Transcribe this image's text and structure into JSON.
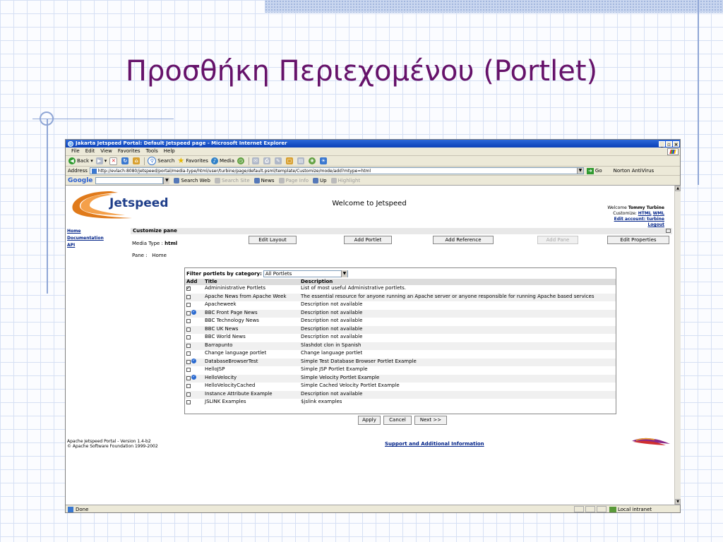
{
  "slide": {
    "title": "Προσθήκη Περιεχομένου (Portlet)"
  },
  "browser": {
    "title": "Jakarta Jetspeed Portal: Default Jetspeed page - Microsoft Internet Explorer",
    "window_buttons": [
      "_",
      "▫",
      "×"
    ],
    "menu": [
      "File",
      "Edit",
      "View",
      "Favorites",
      "Tools",
      "Help"
    ],
    "toolbar": {
      "back": "Back",
      "search": "Search",
      "favorites": "Favorites",
      "media": "Media"
    },
    "address_label": "Address",
    "url": "http://evlach:8080/jetspeed/portal/media-type/html/user/turbine/page/default.psml/template/Customize/mode/add?mtype=html",
    "go_label": "Go",
    "norton": "Norton AntiVirus",
    "googlebar": {
      "logo": "Google",
      "search_web": "Search Web",
      "search_site": "Search Site",
      "news": "News",
      "page_info": "Page Info",
      "up": "Up",
      "highlight": "Highlight"
    },
    "status": {
      "text": "Done",
      "zone": "Local intranet"
    }
  },
  "portal": {
    "logo_text": "Jetspeed",
    "welcome_center": "Welcome to Jetspeed",
    "welcome_user_prefix": "Welcome",
    "welcome_user": "Tommy Turbine",
    "customize_label": "Customize:",
    "customize_html": "HTML",
    "customize_wml": "WML",
    "edit_account": "Edit account: turbine",
    "logout": "Logout",
    "nav": [
      "Home",
      "Documentation",
      "API"
    ],
    "pane_header": "Customize pane",
    "media_type_label": "Media Type :",
    "media_type_value": "html",
    "pane_label": "Pane :",
    "pane_value": "Home",
    "buttons": {
      "edit_layout": "Edit Layout",
      "add_portlet": "Add Portlet",
      "add_reference": "Add Reference",
      "add_pane": "Add Pane",
      "edit_properties": "Edit Properties"
    },
    "filter": {
      "label": "Filter portlets by category:",
      "selected": "All Portlets"
    },
    "table": {
      "headers": [
        "Add",
        "Title",
        "Description"
      ],
      "rows": [
        {
          "checked": true,
          "badge": false,
          "title": "Admininistrative Portlets",
          "desc": "List of most useful Administrative portlets."
        },
        {
          "checked": false,
          "badge": false,
          "title": "Apache News from Apache Week",
          "desc": "The essential resource for anyone running an Apache server or anyone responsible for running Apache based services"
        },
        {
          "checked": false,
          "badge": false,
          "title": "Apacheweek",
          "desc": "Description not available"
        },
        {
          "checked": false,
          "badge": true,
          "title": "BBC Front Page News",
          "desc": "Description not available"
        },
        {
          "checked": false,
          "badge": false,
          "title": "BBC Technology News",
          "desc": "Description not available"
        },
        {
          "checked": false,
          "badge": false,
          "title": "BBC UK News",
          "desc": "Description not available"
        },
        {
          "checked": false,
          "badge": false,
          "title": "BBC World News",
          "desc": "Description not available"
        },
        {
          "checked": false,
          "badge": false,
          "title": "Barrapunto",
          "desc": "Slashdot clon in Spanish"
        },
        {
          "checked": false,
          "badge": false,
          "title": "Change language portlet",
          "desc": "Change language portlet"
        },
        {
          "checked": false,
          "badge": true,
          "title": "DatabaseBrowserTest",
          "desc": "Simple Test Database Browser Portlet Example"
        },
        {
          "checked": false,
          "badge": false,
          "title": "HelloJSP",
          "desc": "Simple JSP Portlet Example"
        },
        {
          "checked": false,
          "badge": true,
          "title": "HelloVelocity",
          "desc": "Simple Velocity Portlet Example"
        },
        {
          "checked": false,
          "badge": false,
          "title": "HelloVelocityCached",
          "desc": "Simple Cached Velocity Portlet Example"
        },
        {
          "checked": false,
          "badge": false,
          "title": "Instance Attribute Example",
          "desc": "Description not available"
        },
        {
          "checked": false,
          "badge": false,
          "title": "JSLINK Examples",
          "desc": "$jslink examples"
        }
      ]
    },
    "bottom_buttons": {
      "apply": "Apply",
      "cancel": "Cancel",
      "next": "Next >>"
    },
    "footer_line1": "Apache Jetspeed Portal - Version 1.4-b2",
    "footer_line2": "© Apache Software Foundation 1999-2002",
    "support_link": "Support and Additional Information"
  }
}
